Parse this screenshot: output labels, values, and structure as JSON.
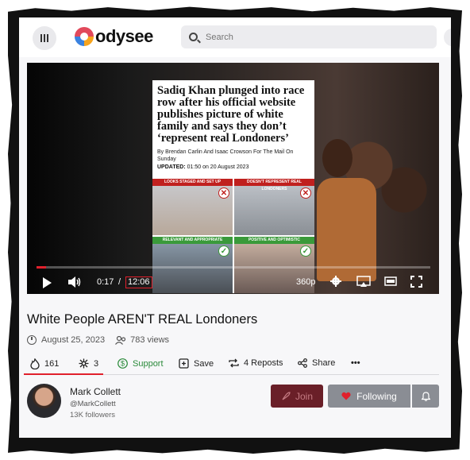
{
  "header": {
    "logo_text": "odysee",
    "search_placeholder": "Search"
  },
  "video": {
    "thumbnail": {
      "headline": "Sadiq Khan plunged into race row after his official website publishes picture of white family and says they don’t ‘represent real Londoners’",
      "byline": "By Brendan Carlin And Isaac Crowson For The Mail On Sunday",
      "updated_label": "UPDATED:",
      "updated_value": "01:50 on 20 August 2023",
      "panels": [
        {
          "label": "LOOKS STAGED AND SET UP",
          "verdict": "✕"
        },
        {
          "label": "DOESN'T REPRESENT REAL LONDONERS",
          "verdict": "✕"
        },
        {
          "label": "RELEVANT AND APPROPRIATE",
          "verdict": "✓"
        },
        {
          "label": "POSITIVE AND OPTIMISTIC",
          "verdict": "✓"
        }
      ]
    },
    "progress": 0.024,
    "current_time": "0:17",
    "time_separator": "/",
    "total_time": "12:06",
    "quality": "360p"
  },
  "title": "White People AREN'T REAL Londoners",
  "meta": {
    "date": "August 25, 2023",
    "views": "783 views"
  },
  "actions": {
    "fire_count": "161",
    "slime_count": "3",
    "support_label": "Support",
    "save_label": "Save",
    "reposts_label": "4 Reposts",
    "share_label": "Share",
    "more_label": "•••"
  },
  "channel": {
    "name": "Mark Collett",
    "handle": "@MarkCollett",
    "followers": "13K followers",
    "join_label": "Join",
    "following_label": "Following"
  },
  "colors": {
    "accent": "#e0202c",
    "support_green": "#2a8a3a",
    "join_bg": "#6a1f28",
    "following_bg": "#8a8d94"
  }
}
